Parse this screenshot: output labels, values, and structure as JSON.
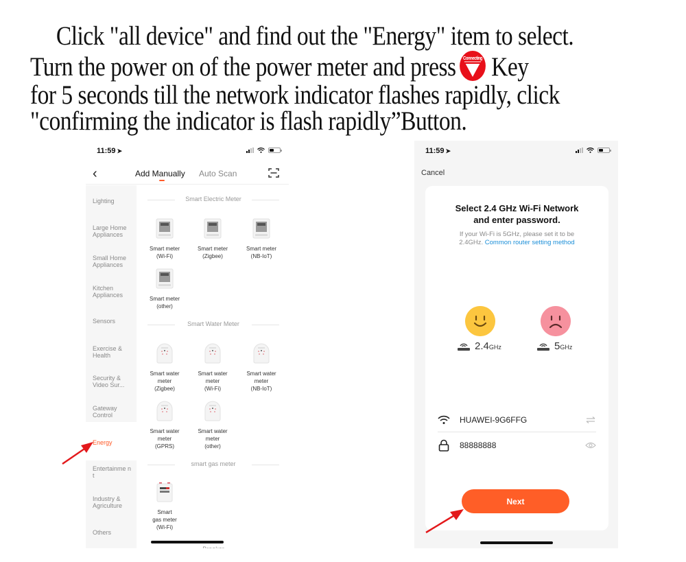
{
  "instructions": {
    "line1": "Click \"all device\" and find out the \"Energy\" item to select.",
    "line2_before": "Turn the power on of the power meter and  press",
    "line2_after": "Key",
    "line3": "for 5 seconds till the network indicator flashes rapidly, click",
    "line4": "\"confirming the indicator is flash rapidly”Button.",
    "badge_label": "Connecting"
  },
  "colors": {
    "accent": "#ff5a28",
    "link": "#1c8fd8",
    "badge_red": "#e8101a",
    "happy": "#fcc63f",
    "sad": "#f6919e"
  },
  "left_phone": {
    "status": {
      "time": "11:59",
      "location_icon": "location-arrow-icon"
    },
    "nav": {
      "back_icon": "chevron-left-icon",
      "tab_manual": "Add Manually",
      "tab_scan": "Auto Scan",
      "scan_icon": "scan-icon",
      "active_tab": "Add Manually"
    },
    "sidebar": [
      {
        "label": "Lighting"
      },
      {
        "label": "Large Home Appliances"
      },
      {
        "label": "Small Home Appliances"
      },
      {
        "label": "Kitchen Appliances"
      },
      {
        "label": "Sensors"
      },
      {
        "label": "Exercise & Health"
      },
      {
        "label": "Security & Video Sur..."
      },
      {
        "label": "Gateway Control"
      },
      {
        "label": "Energy",
        "active": true
      },
      {
        "label": "Entertainme nt"
      },
      {
        "label": "Industry & Agriculture"
      },
      {
        "label": "Others"
      }
    ],
    "sections": [
      {
        "title": "Smart Electric Meter",
        "devices": [
          {
            "l1": "Smart meter",
            "l2": "(Wi-Fi)"
          },
          {
            "l1": "Smart meter",
            "l2": "(Zigbee)"
          },
          {
            "l1": "Smart meter",
            "l2": "(NB-IoT)"
          },
          {
            "l1": "Smart meter",
            "l2": "(other)"
          }
        ]
      },
      {
        "title": "Smart Water Meter",
        "devices": [
          {
            "l1": "Smart water",
            "l2": "meter",
            "l3": "(Zigbee)"
          },
          {
            "l1": "Smart water",
            "l2": "meter",
            "l3": "(Wi-Fi)"
          },
          {
            "l1": "Smart water",
            "l2": "meter",
            "l3": "(NB-IoT)"
          },
          {
            "l1": "Smart water",
            "l2": "meter",
            "l3": "(GPRS)"
          },
          {
            "l1": "Smart water",
            "l2": "meter",
            "l3": "(other)"
          }
        ]
      },
      {
        "title": "smart gas meter",
        "devices": [
          {
            "l1": "Smart",
            "l2": "gas meter",
            "l3": "(Wi-Fi)"
          }
        ]
      },
      {
        "title": "Breaker"
      }
    ]
  },
  "right_phone": {
    "status": {
      "time": "11:59"
    },
    "cancel": "Cancel",
    "title_l1": "Select 2.4 GHz Wi-Fi Network",
    "title_l2": "and enter password.",
    "sub_l1": "If your Wi-Fi is 5GHz, please set it to be",
    "sub_l2_prefix": "2.4GHz.",
    "sub_link": "Common router setting method",
    "freq_ok": {
      "main": "2.4",
      "unit": "GHz",
      "face": "happy"
    },
    "freq_bad": {
      "main": "5",
      "unit": "GHz",
      "face": "sad"
    },
    "wifi_name": "HUAWEI-9G6FFG",
    "password": "88888888",
    "next": "Next"
  }
}
